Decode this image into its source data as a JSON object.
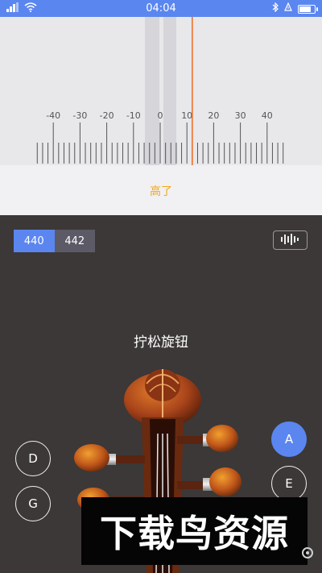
{
  "status_bar": {
    "time": "04:04",
    "battery_level": 0.85,
    "icons": [
      "signal-icon",
      "wifi-icon",
      "bluetooth-icon",
      "vibrate-icon",
      "battery-icon"
    ]
  },
  "gauge": {
    "tick_labels": [
      "-40",
      "-30",
      "-20",
      "-10",
      "0",
      "10",
      "20",
      "30",
      "40"
    ],
    "needle_cents": 12,
    "needle_color": "#f06a1e"
  },
  "tuning_status": "高了",
  "reference_frequency": {
    "options": [
      "440",
      "442"
    ],
    "selected": "440"
  },
  "instruction": "拧松旋钮",
  "strings": {
    "left": [
      "D",
      "G"
    ],
    "right": [
      "A",
      "E"
    ],
    "selected": "A"
  },
  "watermark": "下载鸟资源",
  "colors": {
    "accent": "#5b86f0",
    "status_text": "#f0a81a",
    "dark_bg": "#3b3837"
  }
}
